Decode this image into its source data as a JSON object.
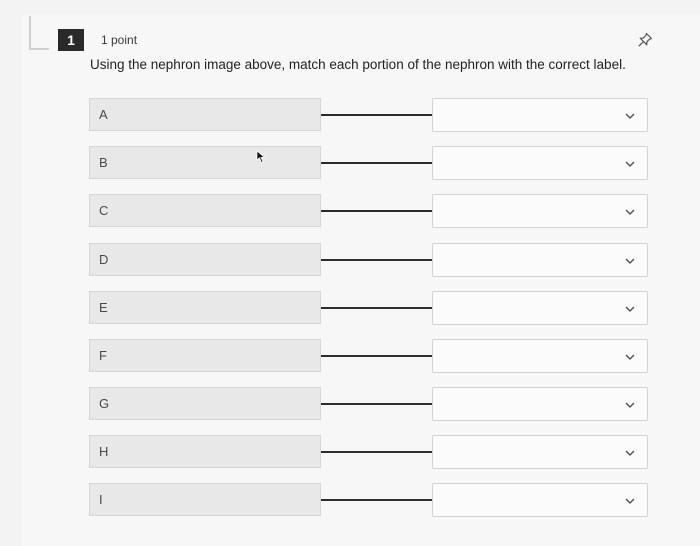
{
  "question": {
    "number": "1",
    "points": "1 point",
    "prompt": "Using the nephron image above, match each portion of the nephron with the correct label.",
    "pin_icon": "pin-icon"
  },
  "pairs": [
    {
      "label": "A",
      "selected": ""
    },
    {
      "label": "B",
      "selected": ""
    },
    {
      "label": "C",
      "selected": ""
    },
    {
      "label": "D",
      "selected": ""
    },
    {
      "label": "E",
      "selected": ""
    },
    {
      "label": "F",
      "selected": ""
    },
    {
      "label": "G",
      "selected": ""
    },
    {
      "label": "H",
      "selected": ""
    },
    {
      "label": "I",
      "selected": ""
    }
  ],
  "icons": {
    "dropdown": "chevron-down-icon",
    "cursor": "mouse-cursor-icon"
  }
}
